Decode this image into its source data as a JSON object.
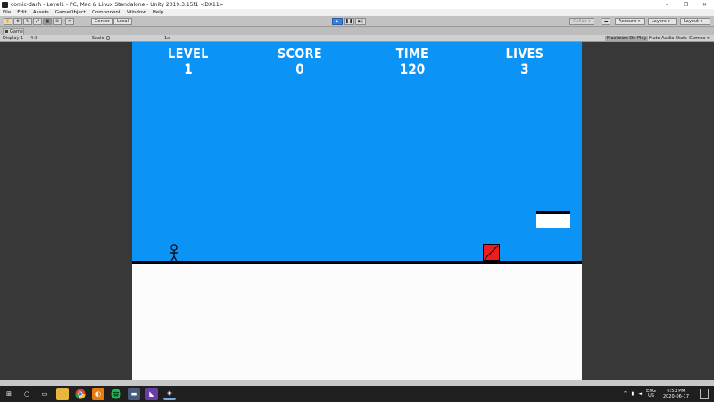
{
  "window": {
    "title": "comic-dash - Level1 - PC, Mac & Linux Standalone - Unity 2019.3.15f1 <DX11>",
    "buttons": [
      "–",
      "❐",
      "✕"
    ]
  },
  "menu": [
    "File",
    "Edit",
    "Assets",
    "GameObject",
    "Component",
    "Window",
    "Help"
  ],
  "toolbar": {
    "pivot_label": "Center",
    "space_label": "Local",
    "collab_label": "Collab ▾",
    "account_label": "Account ▾",
    "layers_label": "Layers ▾",
    "layout_label": "Layout ▾"
  },
  "game_tab": {
    "label": "Game"
  },
  "game_controls": {
    "display_label": "Display 1",
    "aspect_label": "4:3",
    "scale_label": "Scale",
    "scale_value": "1x",
    "maximize_label": "Maximize On Play",
    "mute_label": "Mute Audio",
    "stats_label": "Stats",
    "gizmos_label": "Gizmos ▾"
  },
  "hud": {
    "level_label": "LEVEL",
    "level_value": "1",
    "score_label": "SCORE",
    "score_value": "0",
    "time_label": "TIME",
    "time_value": "120",
    "lives_label": "LIVES",
    "lives_value": "3"
  },
  "colors": {
    "sky": "#0b93f5",
    "ground": "#fcfcfc",
    "box": "#ee1d1d",
    "play_button": "#3c7fd6"
  },
  "taskbar": {
    "icons": [
      "windows-logo",
      "search",
      "task-view",
      "file-explorer",
      "chrome",
      "blender",
      "spotify",
      "monitor",
      "visual-studio",
      "unity"
    ],
    "lang_top": "ENG",
    "lang_bottom": "US",
    "time": "6:53 PM",
    "date": "2020-06-17"
  }
}
